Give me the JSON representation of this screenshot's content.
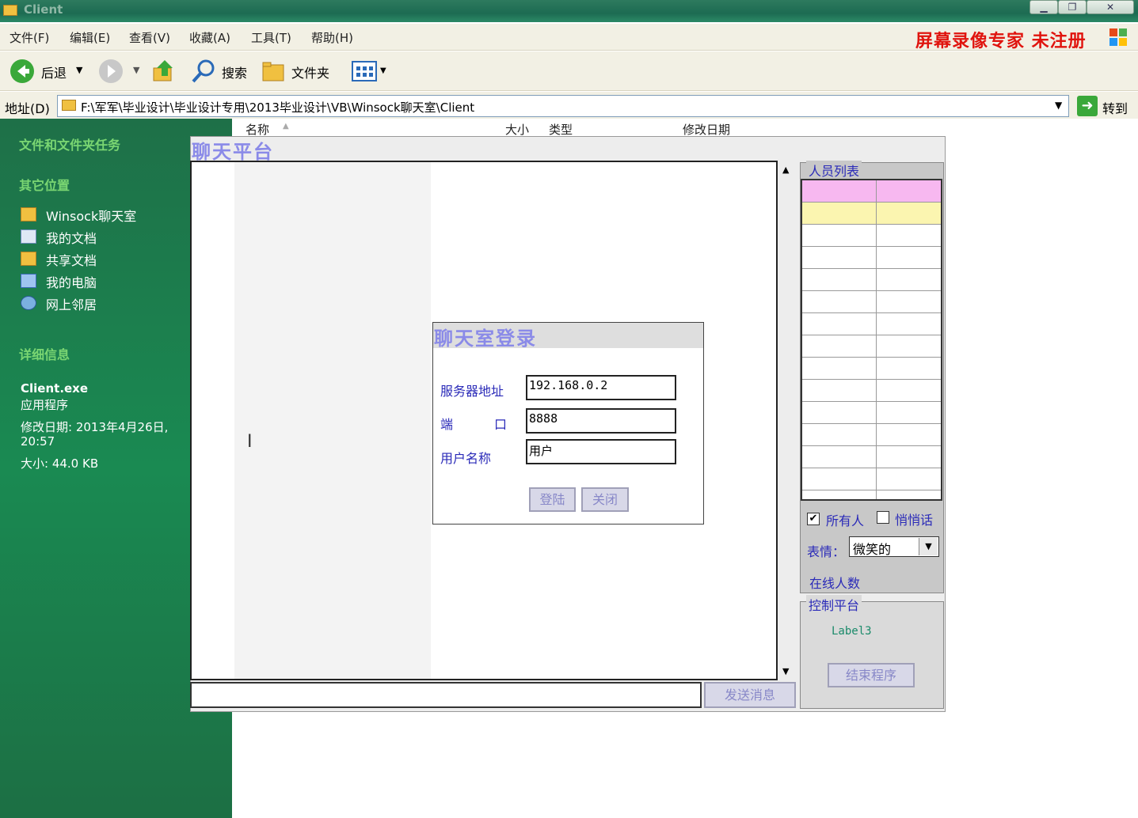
{
  "explorer": {
    "window_title": "Client",
    "menu": [
      "文件(F)",
      "编辑(E)",
      "查看(V)",
      "收藏(A)",
      "工具(T)",
      "帮助(H)"
    ],
    "watermark": "屏幕录像专家  未注册",
    "toolbar": {
      "back": "后退",
      "search": "搜索",
      "folders": "文件夹"
    },
    "address_label": "地址(D)",
    "address_path": "F:\\军军\\毕业设计\\毕业设计专用\\2013毕业设计\\VB\\Winsock聊天室\\Client",
    "goto": "转到",
    "task_pane": {
      "file_tasks": "文件和文件夹任务",
      "other_places": "其它位置",
      "places": [
        "Winsock聊天室",
        "我的文档",
        "共享文档",
        "我的电脑",
        "网上邻居"
      ],
      "details_title": "详细信息",
      "file_name": "Client.exe",
      "file_type": "应用程序",
      "modified": "修改日期: 2013年4月26日,",
      "modified_time": "20:57",
      "size": "大小: 44.0 KB"
    },
    "columns": {
      "name": "名称",
      "size": "大小",
      "type": "类型",
      "modified": "修改日期"
    }
  },
  "chat": {
    "title": "聊天平台",
    "send_button": "发送消息",
    "member_list": {
      "legend": "人员列表",
      "colors": {
        "header": "#f7b8f0",
        "selected": "#fbf5b0"
      }
    },
    "all_people": "所有人",
    "all_people_checked": true,
    "whisper": "悄悄话",
    "whisper_checked": false,
    "mood_label": "表情：",
    "mood_value": "微笑的",
    "online_count": "在线人数",
    "control": {
      "legend": "控制平台",
      "label": "Label3",
      "end_button": "结束程序"
    }
  },
  "login": {
    "title": "聊天室登录",
    "server_label": "服务器地址",
    "server_value": "192.168.0.2",
    "port_label_left": "端",
    "port_label_right": "口",
    "port_value": "8888",
    "user_label": "用户名称",
    "user_value": "用户",
    "login_button": "登陆",
    "close_button": "关闭"
  }
}
